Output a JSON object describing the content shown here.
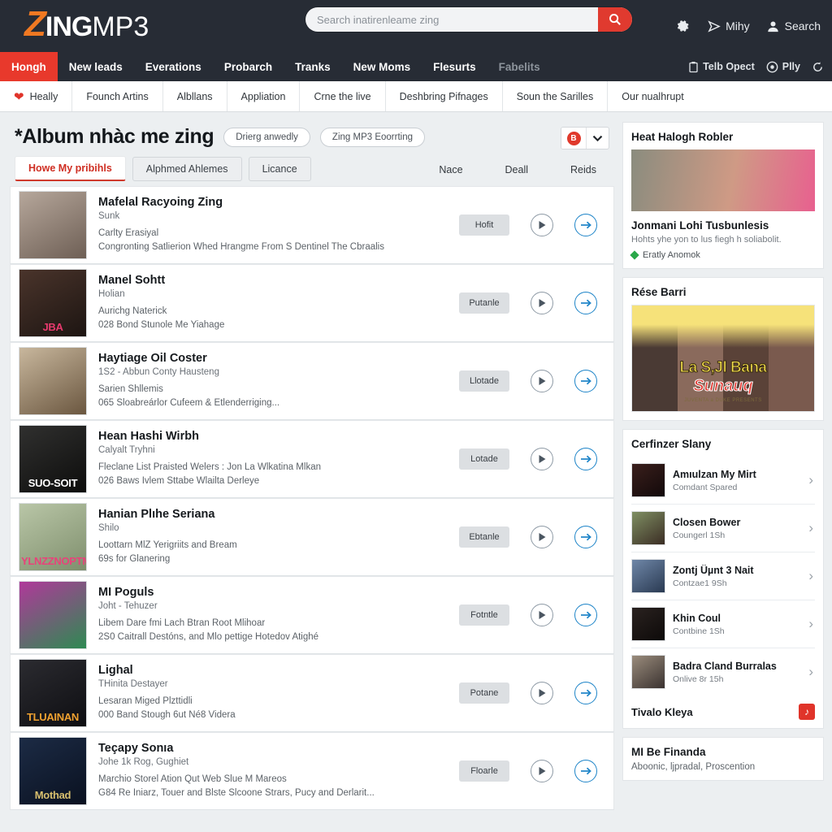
{
  "brand": {
    "z": "Z",
    "ing": "ING",
    "mp3": "MP3",
    "accent": "#f07922",
    "red": "#e8392c"
  },
  "search": {
    "placeholder": "Search inatirenleame zing",
    "value": "",
    "icon": "search-icon"
  },
  "topbar_right": [
    {
      "icon": "gear-icon",
      "label": ""
    },
    {
      "icon": "send-icon",
      "label": "Mihy"
    },
    {
      "icon": "user-icon",
      "label": "Search"
    }
  ],
  "mainnav": {
    "items": [
      {
        "label": "Hongh",
        "active": true
      },
      {
        "label": "New leads",
        "active": false
      },
      {
        "label": "Everations",
        "active": false
      },
      {
        "label": "Probarch",
        "active": false
      },
      {
        "label": "Tranks",
        "active": false
      },
      {
        "label": "New Moms",
        "active": false
      },
      {
        "label": "Flesurts",
        "active": false
      },
      {
        "label": "Fabelits",
        "active": false,
        "dim": true
      }
    ],
    "right": [
      {
        "icon": "clipboard-icon",
        "label": "Telb Opect"
      },
      {
        "icon": "disc-icon",
        "label": "Plly"
      },
      {
        "icon": "refresh-icon",
        "label": ""
      }
    ]
  },
  "subnav": {
    "items": [
      {
        "label": "Heally",
        "icon": "heart-icon"
      },
      {
        "label": "Founch Artins"
      },
      {
        "label": "Albllans"
      },
      {
        "label": "Appliation"
      },
      {
        "label": "Crne the live"
      },
      {
        "label": "Deshbring Pifnages"
      },
      {
        "label": "Soun the Sarilles"
      },
      {
        "label": "Our nualhrupt"
      }
    ]
  },
  "page": {
    "title": "*Album nhàc me zing",
    "pills": [
      "Drierg anwedly",
      "Zing MP3 Eoorrting"
    ],
    "avatar_initial": "B",
    "caret": "chevron-down-icon"
  },
  "tabs": [
    {
      "label": "Howe My pribihls",
      "active": true
    },
    {
      "label": "Alphmed Ahlemes",
      "active": false
    },
    {
      "label": "Licance",
      "active": false
    }
  ],
  "column_headers": [
    "Nace",
    "Deall",
    "Reids"
  ],
  "songs": [
    {
      "title": "Mafelal Racyoing Zing",
      "sub1": "Sunk",
      "line1": "Carlty Erasiyal",
      "line2": "Congronting Satlierion Whed Hrangme From S Dentinel The Cbraalis",
      "tag": "Hofit",
      "thumb": {
        "c1": "#b6a79b",
        "c2": "#6e5f55",
        "overlay": "",
        "ov_color": "#ffffff"
      }
    },
    {
      "title": "Manel Sohtt",
      "sub1": "Holian",
      "line1": "Aurichg Naterick",
      "line2": "028 Bond Stunole Me Yiahage",
      "tag": "Putanle",
      "thumb": {
        "c1": "#4a342b",
        "c2": "#1d1512",
        "overlay": "JBA",
        "ov_color": "#e83a6e"
      }
    },
    {
      "title": "Haytiage Oil Coster",
      "sub1": "1S2 - Abbun Conty Hausteng",
      "line1": "Sarien Shllemis",
      "line2": "065 Sloabreárlor Cufeem & Etlenderriging...",
      "tag": "Llotade",
      "thumb": {
        "c1": "#c8b79d",
        "c2": "#6b5740",
        "overlay": "",
        "ov_color": "#ffffff"
      }
    },
    {
      "title": "Hean Hashi Wirbh",
      "sub1": "Calyalt Tryhni",
      "line1": "Fleclane List Praisted Welers : Jon La Wlkatina Mlkan",
      "line2": "026 Baws Ivlem Sttabe Wlailta Derleye",
      "tag": "Lotade",
      "thumb": {
        "c1": "#30302f",
        "c2": "#0d0d0c",
        "overlay": "SUO-SOIT",
        "ov_color": "#ffffff"
      }
    },
    {
      "title": "Hanian Plıhe Seriana",
      "sub1": "Shilo",
      "line1": "Loottarn MlZ Yerigriits and Bream",
      "line2": "69s for Glanering",
      "tag": "Ebtanle",
      "thumb": {
        "c1": "#b9c6a7",
        "c2": "#7f8f6d",
        "overlay": "YLNZZNOPTMP",
        "ov_color": "#e8437a"
      }
    },
    {
      "title": "MI Poguls",
      "sub1": "Joht - Tehuzer",
      "line1": "Libem Dare fmi Lach Btran Root Mlihoar",
      "line2": "2S0 Caitrall Destóns, and Mlo pettige Hotedov Atighé",
      "tag": "Fotntle",
      "thumb": {
        "c1": "#b0389a",
        "c2": "#2e8a52",
        "overlay": "",
        "ov_color": "#ffffff"
      }
    },
    {
      "title": "Lighal",
      "sub1": "THinita Destayer",
      "line1": "Lesaran Miged Plzttidli",
      "line2": "000 Band Stough 6ut Né8 Videra",
      "tag": "Potane",
      "thumb": {
        "c1": "#2b2b30",
        "c2": "#0e0e12",
        "overlay": "TLUAINAN",
        "ov_color": "#f0a130"
      }
    },
    {
      "title": "Teçapy Sonıa",
      "sub1": "Johe 1k Rog, Gughiet",
      "line1": "Marchio Storel Ation Qut Web Slue M Mareos",
      "line2": "G84 Re Iniarz, Touer and Blste Slcoone Strars, Pucy and Derlarit...",
      "tag": "Floarle",
      "thumb": {
        "c1": "#1c2b45",
        "c2": "#0a1120",
        "overlay": "Mothad",
        "ov_color": "#d8bf6e"
      }
    }
  ],
  "sidebar": {
    "card1": {
      "header": "Heat Halogh Robler",
      "title": "Jonmani Lohi Tusbunlesis",
      "sub": "Hohts yhe yon to lus fiegh h soliabolit.",
      "badge": "Eratly Anomok",
      "badge_icon": "diamond-icon",
      "badge_color": "#2aa84a",
      "img_c1": "#8a8c7e",
      "img_c2": "#cf9a85"
    },
    "card2": {
      "header": "Rése Barri",
      "poster_t1": "La S,Jl Bana",
      "poster_t2": "Sunauq",
      "poster_t3": "JUVENTA a DUKE PRESENTS"
    },
    "card3": {
      "header": "Cerfinzer Slany",
      "items": [
        {
          "title": "Amıulzan My Mirt",
          "sub": "Comdant Spared",
          "c1": "#3a1f1c",
          "c2": "#12090a"
        },
        {
          "title": "Closen Bower",
          "sub": "Coungerl 1Sh",
          "c1": "#7f8f63",
          "c2": "#3b2d24"
        },
        {
          "title": "Zontj Üµnt 3 Nait",
          "sub": "Contzae1 9Sh",
          "c1": "#6f87a8",
          "c2": "#2a3a52"
        },
        {
          "title": "Khin Coul",
          "sub": "Contbine 1Sh",
          "c1": "#2a2220",
          "c2": "#0d0a09"
        },
        {
          "title": "Badra Cland Burralas",
          "sub": "Onlive 8r 15h",
          "c1": "#9a8c7c",
          "c2": "#3a3230"
        }
      ],
      "footer_title": "Tivalo Kleya",
      "footer_badge": "♪"
    },
    "card4": {
      "title": "MI Be Finanda",
      "sub": "Aboonic, ljpradal, Proscention"
    }
  }
}
